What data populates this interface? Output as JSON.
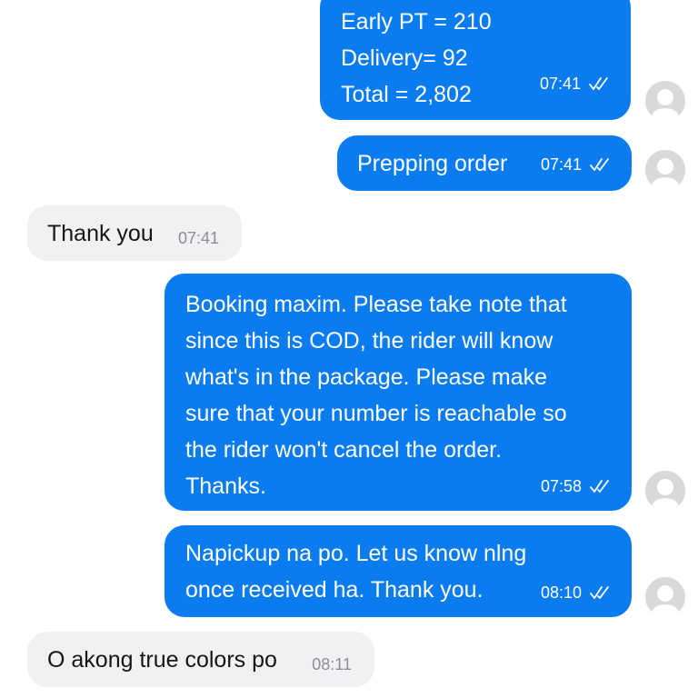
{
  "messages": [
    {
      "direction": "outgoing",
      "lines": [
        "Early PT = 210",
        "Delivery= 92",
        "Total = 2,802"
      ],
      "time": "07:41",
      "status": "double-check-icon"
    },
    {
      "direction": "outgoing",
      "lines": [
        "Prepping order"
      ],
      "time": "07:41",
      "status": "double-check-icon"
    },
    {
      "direction": "incoming",
      "lines": [
        "Thank you"
      ],
      "time": "07:41"
    },
    {
      "direction": "outgoing",
      "lines": [
        "Booking maxim. Please take note that",
        "since this is COD, the rider will know",
        "what's in the package. Please make",
        "sure that your number is reachable so",
        "the rider won't cancel the order.",
        "Thanks."
      ],
      "time": "07:58",
      "status": "double-check-icon"
    },
    {
      "direction": "outgoing",
      "lines": [
        "Napickup na po. Let us know nlng",
        "once received ha. Thank you."
      ],
      "time": "08:10",
      "status": "double-check-icon"
    },
    {
      "direction": "incoming",
      "lines": [
        "O akong true colors po"
      ],
      "time": "08:11"
    }
  ],
  "colors": {
    "outgoing_bubble": "#0a7cf0",
    "incoming_bubble": "#f1f1f3",
    "incoming_time": "#8d8d93",
    "avatar": "#d9d9dc"
  },
  "icons": {
    "avatar": "person-placeholder-icon",
    "read_status": "double-check-icon"
  }
}
